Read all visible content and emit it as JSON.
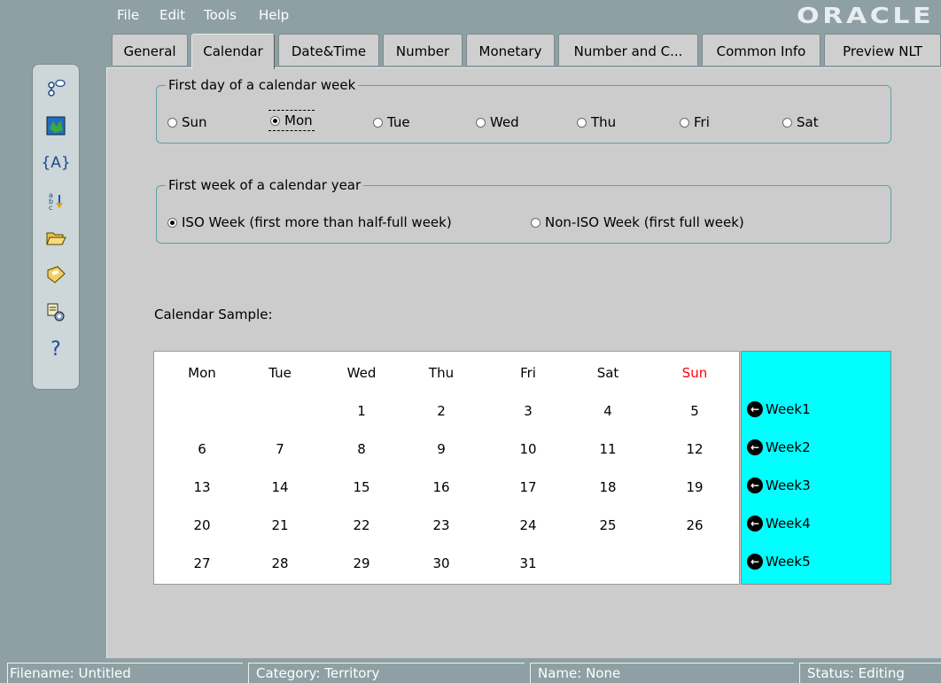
{
  "menu": {
    "file": "File",
    "edit": "Edit",
    "tools": "Tools",
    "help": "Help",
    "brand": "ORACLE"
  },
  "tabs": [
    {
      "label": "General"
    },
    {
      "label": "Calendar"
    },
    {
      "label": "Date&Time"
    },
    {
      "label": "Number"
    },
    {
      "label": "Monetary"
    },
    {
      "label": "Number and C..."
    },
    {
      "label": "Common Info"
    },
    {
      "label": "Preview NLT"
    }
  ],
  "toolbar": {
    "icons": [
      "object-browser-icon",
      "map-icon",
      "variable-icon",
      "sort-icon",
      "open-folder-icon",
      "save-disk-icon",
      "settings-icon",
      "help-icon"
    ]
  },
  "first_day": {
    "title": "First day of a calendar week",
    "options": [
      "Sun",
      "Mon",
      "Tue",
      "Wed",
      "Thu",
      "Fri",
      "Sat"
    ],
    "selected": "Mon"
  },
  "first_week": {
    "title": "First week of a calendar year",
    "iso": "ISO Week (first more than half-full week)",
    "non_iso": "Non-ISO Week (first full week)",
    "selected": "iso"
  },
  "calendar": {
    "sample_label": "Calendar Sample:",
    "headers": [
      "Mon",
      "Tue",
      "Wed",
      "Thu",
      "Fri",
      "Sat",
      "Sun"
    ],
    "sunday_color": "#ff0000",
    "weeks": [
      [
        "",
        "",
        "1",
        "2",
        "3",
        "4",
        "5"
      ],
      [
        "6",
        "7",
        "8",
        "9",
        "10",
        "11",
        "12"
      ],
      [
        "13",
        "14",
        "15",
        "16",
        "17",
        "18",
        "19"
      ],
      [
        "20",
        "21",
        "22",
        "23",
        "24",
        "25",
        "26"
      ],
      [
        "27",
        "28",
        "29",
        "30",
        "31",
        "",
        ""
      ]
    ],
    "week_labels": [
      "Week1",
      "Week2",
      "Week3",
      "Week4",
      "Week5"
    ],
    "week_column_color": "#00ffff"
  },
  "status": {
    "filename": "Filename: Untitled",
    "category": "Category: Territory",
    "name": "Name: None",
    "status": "Status: Editing"
  }
}
